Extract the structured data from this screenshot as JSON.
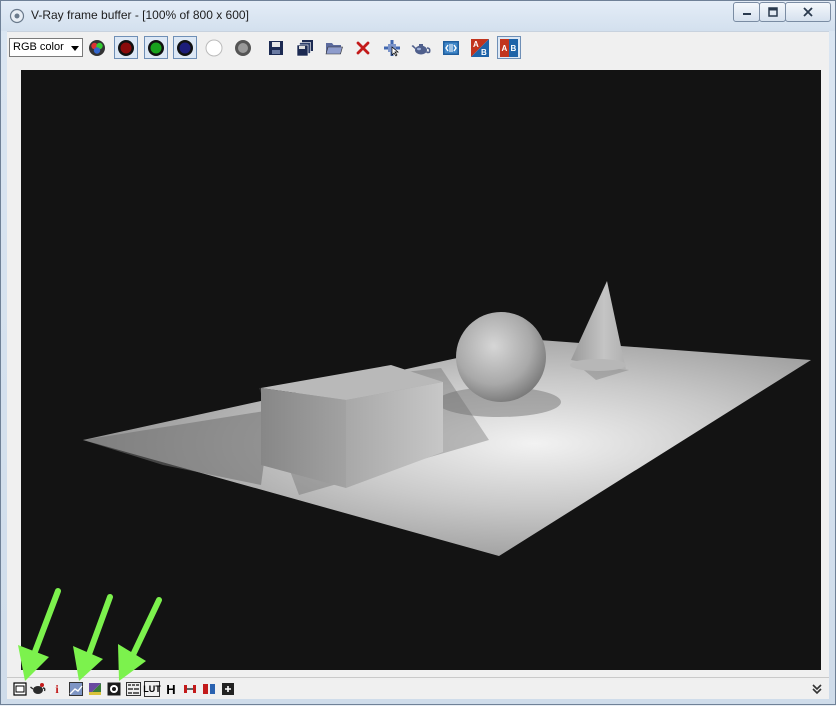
{
  "window": {
    "title": "V-Ray frame buffer - [100% of 800 x 600]"
  },
  "toolbar": {
    "channel_select": "RGB color",
    "buttons": [
      "color-channels-icon",
      "red-channel-icon",
      "green-channel-icon",
      "blue-channel-icon",
      "alpha-channel-icon",
      "monochrome-icon",
      "save-icon",
      "save-all-icon",
      "open-icon",
      "clear-icon",
      "track-mouse-icon",
      "render-teapot-icon",
      "vfb-history-icon",
      "ab-compare-horizontal-icon",
      "ab-compare-vertical-icon"
    ]
  },
  "statusbar": {
    "info_label": "i",
    "lut_label": "LUT",
    "h_label": "H"
  },
  "colors": {
    "arrow": "#7cf24d",
    "viewport_bg": "#131313"
  }
}
